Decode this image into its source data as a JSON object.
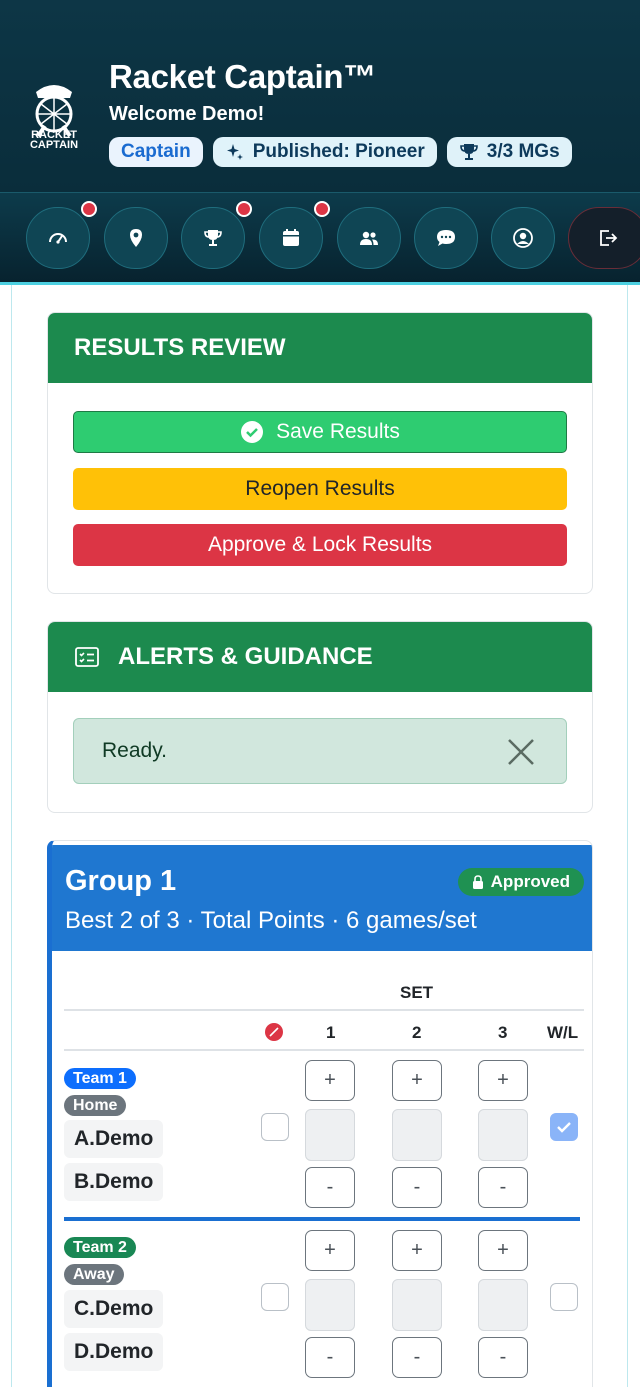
{
  "header": {
    "logo_text": "RACKET CAPTAIN",
    "title": "Racket Captain™",
    "welcome": "Welcome Demo!",
    "badges": {
      "role": "Captain",
      "published": "Published: Pioneer",
      "mgs": "3/3 MGs"
    }
  },
  "nav": {
    "items": [
      {
        "icon": "speedometer-icon",
        "alert": true
      },
      {
        "icon": "map-pin-icon",
        "alert": false
      },
      {
        "icon": "trophy-icon",
        "alert": true
      },
      {
        "icon": "calendar-icon",
        "alert": true
      },
      {
        "icon": "people-icon",
        "alert": false
      },
      {
        "icon": "chat-icon",
        "alert": false
      },
      {
        "icon": "user-circle-icon",
        "alert": false
      },
      {
        "icon": "logout-icon",
        "alert": false
      }
    ]
  },
  "results_review": {
    "title": "RESULTS REVIEW",
    "save_label": "Save Results",
    "reopen_label": "Reopen Results",
    "approve_label": "Approve & Lock Results"
  },
  "alerts": {
    "title": "ALERTS & GUIDANCE",
    "message": "Ready."
  },
  "group": {
    "title": "Group 1",
    "subtitle": "Best 2 of 3 · Total Points · 6 games/set",
    "status": "Approved",
    "table": {
      "set_header": "SET",
      "set_numbers": [
        "1",
        "2",
        "3"
      ],
      "wl_header": "W/L"
    },
    "teams": [
      {
        "team_label": "Team 1",
        "side": "Home",
        "players": [
          "A.Demo",
          "B.Demo"
        ],
        "forfeit": false,
        "win": true
      },
      {
        "team_label": "Team 2",
        "side": "Away",
        "players": [
          "C.Demo",
          "D.Demo"
        ],
        "forfeit": false,
        "win": false
      }
    ],
    "plus": "+",
    "minus": "-"
  },
  "colors": {
    "header_bg": "#0d3646",
    "card_header_green": "#1c8a4e",
    "group_blue": "#1f77d0",
    "save_green": "#2ecc71",
    "reopen_yellow": "#ffc107",
    "approve_red": "#dc3545"
  }
}
